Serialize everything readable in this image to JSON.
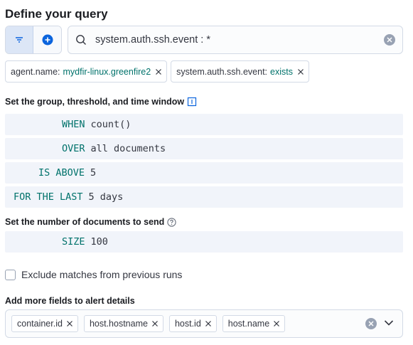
{
  "header": {
    "title": "Define your query"
  },
  "query": {
    "text": "system.auth.ssh.event : *"
  },
  "filters": [
    {
      "field": "agent.name:",
      "value": "mydfir-linux.greenfire2"
    },
    {
      "field": "system.auth.ssh.event:",
      "value": "exists"
    }
  ],
  "group_section": {
    "label": "Set the group, threshold, and time window"
  },
  "expressions": {
    "when": {
      "keyword": "WHEN",
      "value": "count()"
    },
    "over": {
      "keyword": "OVER",
      "value": "all documents"
    },
    "above": {
      "keyword": "IS ABOVE",
      "value": "5"
    },
    "last": {
      "keyword": "FOR THE LAST",
      "value": "5 days"
    }
  },
  "docs_section": {
    "label": "Set the number of documents to send"
  },
  "size": {
    "keyword": "SIZE",
    "value": "100"
  },
  "exclude": {
    "label": "Exclude matches from previous runs",
    "checked": false
  },
  "fields_section": {
    "label": "Add more fields to alert details",
    "chips": [
      "container.id",
      "host.hostname",
      "host.id",
      "host.name"
    ]
  },
  "colors": {
    "accent": "#00726b",
    "primary": "#0b64dd"
  }
}
